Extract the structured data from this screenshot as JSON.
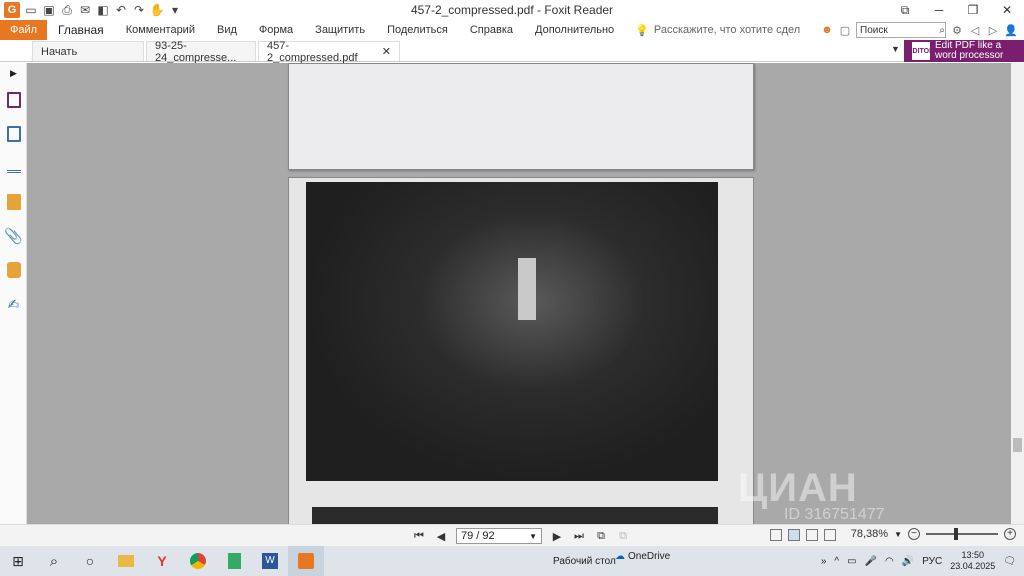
{
  "window": {
    "title": "457-2_compressed.pdf - Foxit Reader",
    "app_logo": "G"
  },
  "menu": {
    "file": "Файл",
    "items": [
      "Главная",
      "Комментарий",
      "Вид",
      "Форма",
      "Защитить",
      "Поделиться",
      "Справка",
      "Дополнительно"
    ],
    "tellme": "Расскажите, что хотите сдел",
    "search_placeholder": "Поиск"
  },
  "tabs": [
    {
      "label": "Начать"
    },
    {
      "label": "93-25-24_compresse..."
    },
    {
      "label": "457-2_compressed.pdf"
    }
  ],
  "promo": {
    "icon_text": "EDITOR",
    "line1": "Edit PDF like a",
    "line2": "word processor"
  },
  "status": {
    "page_display": "79 / 92",
    "zoom": "78,38%"
  },
  "watermark": {
    "brand": "ЦИАН",
    "id": "ID 316751477"
  },
  "taskbar": {
    "desktop_label": "Рабочий стол",
    "onedrive": "OneDrive",
    "lang": "РУС",
    "time": "13:50",
    "date": "23.04.2025"
  },
  "colors": {
    "accent": "#e87722",
    "promo": "#7a1f6d",
    "doc_bg": "#a9a9a9"
  }
}
